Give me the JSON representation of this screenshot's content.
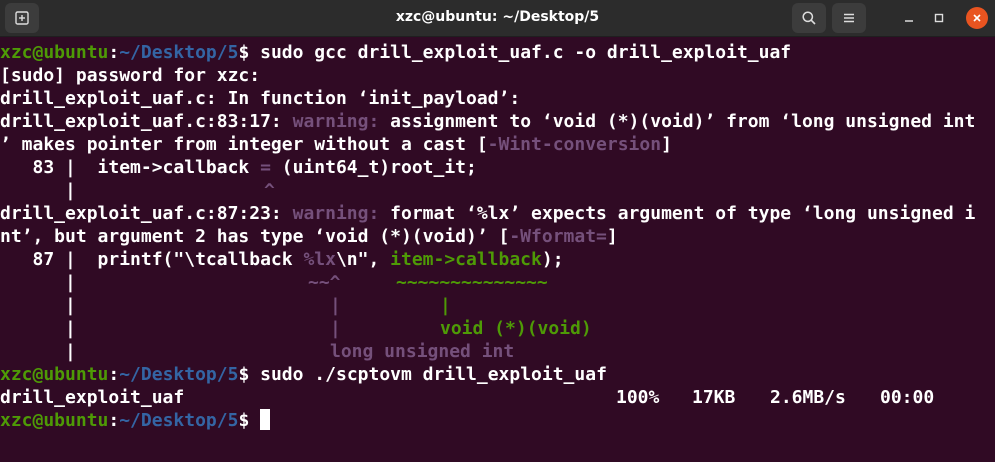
{
  "window": {
    "title": "xzc@ubuntu: ~/Desktop/5"
  },
  "prompt": {
    "user_host": "xzc@ubuntu",
    "sep": ":",
    "path": "~/Desktop/5",
    "symbol": "$"
  },
  "lines": {
    "l1_cmd": " sudo gcc drill_exploit_uaf.c -o drill_exploit_uaf",
    "l2": "[sudo] password for xzc:",
    "l3": "drill_exploit_uaf.c: In function ‘init_payload’:",
    "l4_pre": "drill_exploit_uaf.c:83:17: ",
    "l4_warn": "warning:",
    "l4_post": " assignment to ‘void (*)(void)’ from ‘long unsigned int",
    "l5_pre": "’ makes pointer from integer without a cast [",
    "l5_flag": "-Wint-conversion",
    "l5_post": "]",
    "l6_pre": "   83 |  item->callback ",
    "l6_eq": "=",
    "l6_post": " (uint64_t)root_it;",
    "l7_bar": "      |",
    "l7_caret": "^",
    "l8_pre": "drill_exploit_uaf.c:87:23: ",
    "l8_warn": "warning:",
    "l8_post": " format ‘%lx’ expects argument of type ‘long unsigned i",
    "l9_pre": "nt’, but argument 2 has type ‘void (*)(void)’ [",
    "l9_flag": "-Wformat=",
    "l9_post": "]",
    "l10_pre": "   87 |  printf(\"\\tcallback ",
    "l10_fmt": "%lx",
    "l10_mid": "\\n\", ",
    "l10_arg": "item->callback",
    "l10_post": ");",
    "l11_bar": "      |",
    "l11_tilde1": "~~^",
    "l11_tilde2": "~~~~~~~~~~~~~~",
    "l12_bar": "      |",
    "l12_p1": "|",
    "l12_p2": "|",
    "l13_bar": "      |",
    "l13_p1": "|",
    "l13_type": "void (*)(void)",
    "l14_bar": "      |",
    "l14_type": "long unsigned int",
    "l15_cmd": " sudo ./scptovm drill_exploit_uaf",
    "l16_file": "drill_exploit_uaf",
    "l16_pct": "100%",
    "l16_size": "17KB",
    "l16_rate": "2.6MB/s",
    "l16_time": "00:00"
  },
  "icons": {
    "new_tab": "new-tab-icon",
    "search": "search-icon",
    "menu": "hamburger-menu-icon",
    "minimize": "minimize-icon",
    "maximize": "maximize-icon",
    "close": "close-icon"
  },
  "colors": {
    "background": "#300a24",
    "prompt_user": "#4e9a06",
    "prompt_path": "#3465a4",
    "warning": "#75507b",
    "close_button": "#e95420"
  }
}
